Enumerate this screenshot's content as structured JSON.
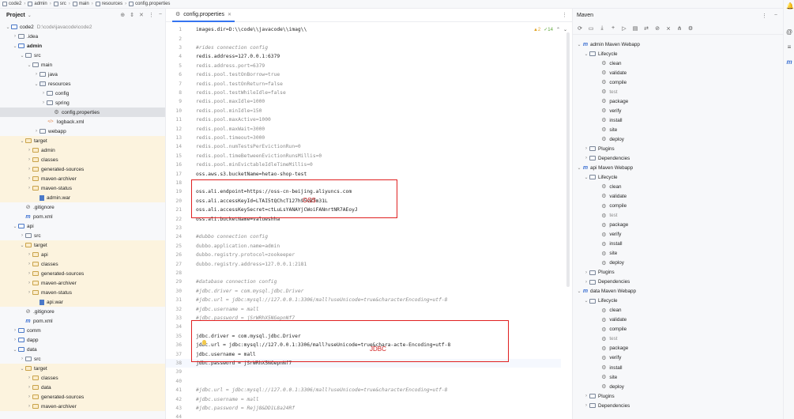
{
  "breadcrumb": [
    "code2",
    "admin",
    "src",
    "main",
    "resources",
    "config.properties"
  ],
  "project": {
    "title": "Project",
    "tree": [
      {
        "label": "code2",
        "path": "D:\\code\\javacode\\code2",
        "indent": 0,
        "arrow": "v",
        "icon": "mod",
        "hl": false
      },
      {
        "label": ".idea",
        "indent": 1,
        "arrow": ">",
        "icon": "fold",
        "hl": false
      },
      {
        "label": "admin",
        "indent": 1,
        "arrow": "v",
        "icon": "mod",
        "hl": false,
        "bold": true
      },
      {
        "label": "src",
        "indent": 2,
        "arrow": "v",
        "icon": "fold",
        "hl": false
      },
      {
        "label": "main",
        "indent": 3,
        "arrow": "v",
        "icon": "fold",
        "hl": false
      },
      {
        "label": "java",
        "indent": 4,
        "arrow": ">",
        "icon": "fold",
        "hl": false
      },
      {
        "label": "resources",
        "indent": 4,
        "arrow": "v",
        "icon": "res",
        "hl": false
      },
      {
        "label": "config",
        "indent": 5,
        "arrow": ">",
        "icon": "fold",
        "hl": false
      },
      {
        "label": "spring",
        "indent": 5,
        "arrow": ">",
        "icon": "fold",
        "hl": false
      },
      {
        "label": "config.properties",
        "indent": 6,
        "arrow": "",
        "icon": "gear",
        "hl": false,
        "sel": true
      },
      {
        "label": "logback.xml",
        "indent": 5,
        "arrow": "",
        "icon": "xml",
        "hl": false
      },
      {
        "label": "webapp",
        "indent": 4,
        "arrow": ">",
        "icon": "fold",
        "hl": false
      },
      {
        "label": "target",
        "indent": 2,
        "arrow": "v",
        "icon": "orange",
        "hl": true
      },
      {
        "label": "admin",
        "indent": 3,
        "arrow": ">",
        "icon": "orange",
        "hl": true
      },
      {
        "label": "classes",
        "indent": 3,
        "arrow": ">",
        "icon": "orange",
        "hl": true
      },
      {
        "label": "generated-sources",
        "indent": 3,
        "arrow": ">",
        "icon": "orange",
        "hl": true
      },
      {
        "label": "maven-archiver",
        "indent": 3,
        "arrow": ">",
        "icon": "orange",
        "hl": true
      },
      {
        "label": "maven-status",
        "indent": 3,
        "arrow": ">",
        "icon": "orange",
        "hl": true
      },
      {
        "label": "admin.war",
        "indent": 4,
        "arrow": "",
        "icon": "war",
        "hl": true
      },
      {
        "label": ".gitignore",
        "indent": 2,
        "arrow": "",
        "icon": "ban",
        "hl": false
      },
      {
        "label": "pom.xml",
        "indent": 2,
        "arrow": "",
        "icon": "m",
        "hl": false
      },
      {
        "label": "api",
        "indent": 1,
        "arrow": "v",
        "icon": "mod",
        "hl": false
      },
      {
        "label": "src",
        "indent": 2,
        "arrow": ">",
        "icon": "fold",
        "hl": false
      },
      {
        "label": "target",
        "indent": 2,
        "arrow": "v",
        "icon": "orange",
        "hl": true
      },
      {
        "label": "api",
        "indent": 3,
        "arrow": ">",
        "icon": "orange",
        "hl": true
      },
      {
        "label": "classes",
        "indent": 3,
        "arrow": ">",
        "icon": "orange",
        "hl": true
      },
      {
        "label": "generated-sources",
        "indent": 3,
        "arrow": ">",
        "icon": "orange",
        "hl": true
      },
      {
        "label": "maven-archiver",
        "indent": 3,
        "arrow": ">",
        "icon": "orange",
        "hl": true
      },
      {
        "label": "maven-status",
        "indent": 3,
        "arrow": ">",
        "icon": "orange",
        "hl": true
      },
      {
        "label": "api.war",
        "indent": 4,
        "arrow": "",
        "icon": "war",
        "hl": true
      },
      {
        "label": ".gitignore",
        "indent": 2,
        "arrow": "",
        "icon": "ban",
        "hl": false
      },
      {
        "label": "pom.xml",
        "indent": 2,
        "arrow": "",
        "icon": "m",
        "hl": false
      },
      {
        "label": "comm",
        "indent": 1,
        "arrow": ">",
        "icon": "mod",
        "hl": false
      },
      {
        "label": "dapp",
        "indent": 1,
        "arrow": ">",
        "icon": "mod",
        "hl": false
      },
      {
        "label": "data",
        "indent": 1,
        "arrow": "v",
        "icon": "mod",
        "hl": false
      },
      {
        "label": "src",
        "indent": 2,
        "arrow": ">",
        "icon": "fold",
        "hl": false
      },
      {
        "label": "target",
        "indent": 2,
        "arrow": "v",
        "icon": "orange",
        "hl": true
      },
      {
        "label": "classes",
        "indent": 3,
        "arrow": ">",
        "icon": "orange",
        "hl": true
      },
      {
        "label": "data",
        "indent": 3,
        "arrow": ">",
        "icon": "orange",
        "hl": true
      },
      {
        "label": "generated-sources",
        "indent": 3,
        "arrow": ">",
        "icon": "orange",
        "hl": true
      },
      {
        "label": "maven-archiver",
        "indent": 3,
        "arrow": ">",
        "icon": "orange",
        "hl": true
      }
    ]
  },
  "editor": {
    "tab_label": "config.properties",
    "inspection_warnings": "▲2",
    "inspection_ok": "✓14",
    "lines": [
      {
        "n": "1",
        "text": "images.dir=D:\\\\code\\\\javacode\\\\imag\\\\",
        "style": "normal"
      },
      {
        "n": "2",
        "text": "",
        "style": "normal"
      },
      {
        "n": "3",
        "text": "#rides connection config",
        "style": "comment"
      },
      {
        "n": "4",
        "text": "redis.address=127.0.0.1:6379",
        "style": "normal"
      },
      {
        "n": "5",
        "text": "redis.address.port=6379",
        "style": "dim"
      },
      {
        "n": "6",
        "text": "redis.pool.testOnBorrow=true",
        "style": "dim"
      },
      {
        "n": "7",
        "text": "redis.pool.testOnReturn=false",
        "style": "dim"
      },
      {
        "n": "8",
        "text": "redis.pool.testWhileIdle=false",
        "style": "dim"
      },
      {
        "n": "9",
        "text": "redis.pool.maxIdle=1000",
        "style": "dim"
      },
      {
        "n": "10",
        "text": "redis.pool.minIdle=150",
        "style": "dim"
      },
      {
        "n": "11",
        "text": "redis.pool.maxActive=1000",
        "style": "dim"
      },
      {
        "n": "12",
        "text": "redis.pool.maxWait=3000",
        "style": "dim"
      },
      {
        "n": "13",
        "text": "redis.pool.timeout=3000",
        "style": "dim"
      },
      {
        "n": "14",
        "text": "redis.pool.numTestsPerEvictionRun=0",
        "style": "dim"
      },
      {
        "n": "15",
        "text": "redis.pool.timeBetweenEvictionRunsMillis=0",
        "style": "dim"
      },
      {
        "n": "16",
        "text": "redis.pool.minEvictableIdleTimeMillis=0",
        "style": "dim"
      },
      {
        "n": "17",
        "text": "oss.aws.s3.bucketName=hetao-shop-test",
        "style": "normal"
      },
      {
        "n": "18",
        "text": "",
        "style": "normal"
      },
      {
        "n": "19",
        "text": "oss.ali.endpoint=https://oss-cn-beijing.aliyuncs.com",
        "style": "normal"
      },
      {
        "n": "20",
        "text": "oss.ali.accessKeyId=LTAI5tQChcT127h95v87m31L",
        "style": "normal"
      },
      {
        "n": "21",
        "text": "oss.ali.accessKeySecret=ctLuLsYANAYjCWoiFANnrtNR7AEoyJ",
        "style": "normal"
      },
      {
        "n": "22",
        "text": "oss.ali.bucketName=valueshha",
        "style": "normal"
      },
      {
        "n": "23",
        "text": "",
        "style": "normal"
      },
      {
        "n": "24",
        "text": "#dubbo connection config",
        "style": "comment"
      },
      {
        "n": "25",
        "text": "dubbo.application.name=admin",
        "style": "dim"
      },
      {
        "n": "26",
        "text": "dubbo.registry.protocol=zookeeper",
        "style": "dim"
      },
      {
        "n": "27",
        "text": "dubbo.registry.address=127.0.0.1:2181",
        "style": "dim"
      },
      {
        "n": "28",
        "text": "",
        "style": "normal"
      },
      {
        "n": "29",
        "text": "#database connection config",
        "style": "comment"
      },
      {
        "n": "30",
        "text": "#jdbc.driver = com.mysql.jdbc.Driver",
        "style": "comment"
      },
      {
        "n": "31",
        "text": "#jdbc.url = jdbc:mysql://127.0.0.1:3306/mall?useUnicode=true&characterEncoding=utf-8",
        "style": "comment"
      },
      {
        "n": "32",
        "text": "#jdbc.username = mall",
        "style": "comment"
      },
      {
        "n": "33",
        "text": "#jdbc.password = jSrWRhX5NGepnNf7",
        "style": "comment"
      },
      {
        "n": "34",
        "text": "",
        "style": "normal"
      },
      {
        "n": "35",
        "text": "jdbc.driver = com.mysql.jdbc.Driver",
        "style": "normal"
      },
      {
        "n": "36",
        "text": "jdbc.url = jdbc:mysql://127.0.0.1:3306/mall?useUnicode=true&chara-acte-Encoding=utf-8",
        "style": "normal"
      },
      {
        "n": "37",
        "text": "jdbc.username = mall",
        "style": "normal"
      },
      {
        "n": "38",
        "text": "jdbc.password = jSrWRhX5NGepnNf7",
        "style": "cur"
      },
      {
        "n": "39",
        "text": "",
        "style": "normal"
      },
      {
        "n": "40",
        "text": "",
        "style": "normal"
      },
      {
        "n": "41",
        "text": "#jdbc.url = jdbc:mysql://127.0.0.1:3306/mall?useUnicode=true&characterEncoding=utf-8",
        "style": "comment"
      },
      {
        "n": "42",
        "text": "#jdbc.username = mall",
        "style": "comment"
      },
      {
        "n": "43",
        "text": "#jdbc.password = Rejj8&DD1L8a24Rf",
        "style": "comment"
      },
      {
        "n": "44",
        "text": "",
        "style": "normal"
      },
      {
        "n": "45",
        "text": "",
        "style": "normal"
      }
    ],
    "annotation_oss": "OSS",
    "annotation_jdbc": "JDBC"
  },
  "maven": {
    "title": "Maven",
    "projects": [
      {
        "name": "admin Maven Webapp",
        "lifecycle_label": "Lifecycle",
        "phases": [
          "clean",
          "validate",
          "compile",
          "test",
          "package",
          "verify",
          "install",
          "site",
          "deploy"
        ],
        "plugins_label": "Plugins",
        "deps_label": "Dependencies"
      },
      {
        "name": "api Maven Webapp",
        "lifecycle_label": "Lifecycle",
        "phases": [
          "clean",
          "validate",
          "compile",
          "test",
          "package",
          "verify",
          "install",
          "site",
          "deploy"
        ],
        "plugins_label": "Plugins",
        "deps_label": "Dependencies"
      },
      {
        "name": "data Maven Webapp",
        "lifecycle_label": "Lifecycle",
        "phases": [
          "clean",
          "validate",
          "compile",
          "test",
          "package",
          "verify",
          "install",
          "site",
          "deploy"
        ],
        "plugins_label": "Plugins",
        "deps_label": "Dependencies"
      }
    ]
  },
  "colors": {
    "accent": "#3574f0",
    "highlight_red": "#e02020",
    "excluded_bg": "#fcf3de"
  }
}
